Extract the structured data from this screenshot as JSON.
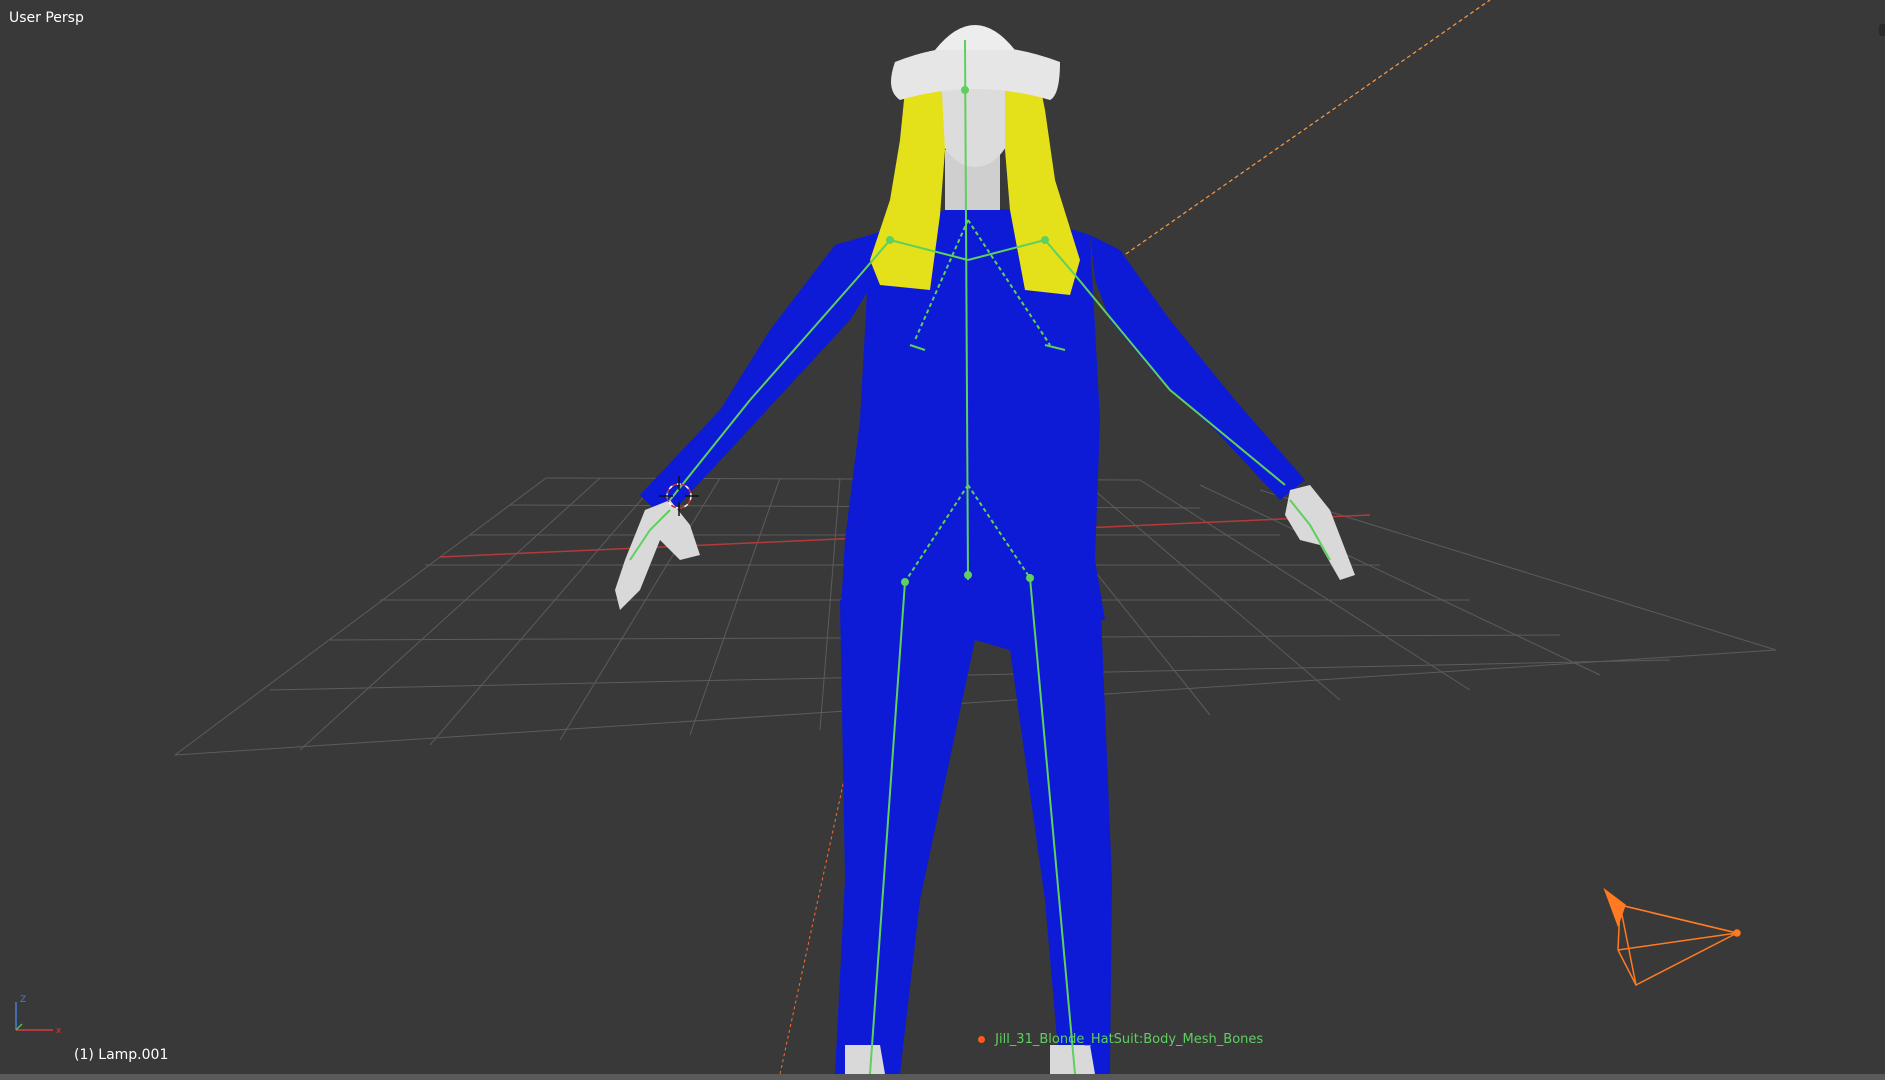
{
  "viewport": {
    "view_label": "User Persp",
    "object_label": "(1) Lamp.001",
    "object_names": "Jill_31_Blonde_HatSuit:Body_Mesh_Bones"
  },
  "colors": {
    "background": "#393939",
    "grid": "#5c5c5c",
    "x_axis": "#b33a3a",
    "suit": "#0d1bd6",
    "hair": "#e4e01a",
    "skin": "#d9d9d9",
    "bones": "#5fcf5f",
    "lamp": "#ff7a20",
    "selected_origin": "#ff5a1a"
  },
  "icons": [
    "3d-cursor-icon",
    "axis-gizmo-icon",
    "lamp-icon"
  ]
}
